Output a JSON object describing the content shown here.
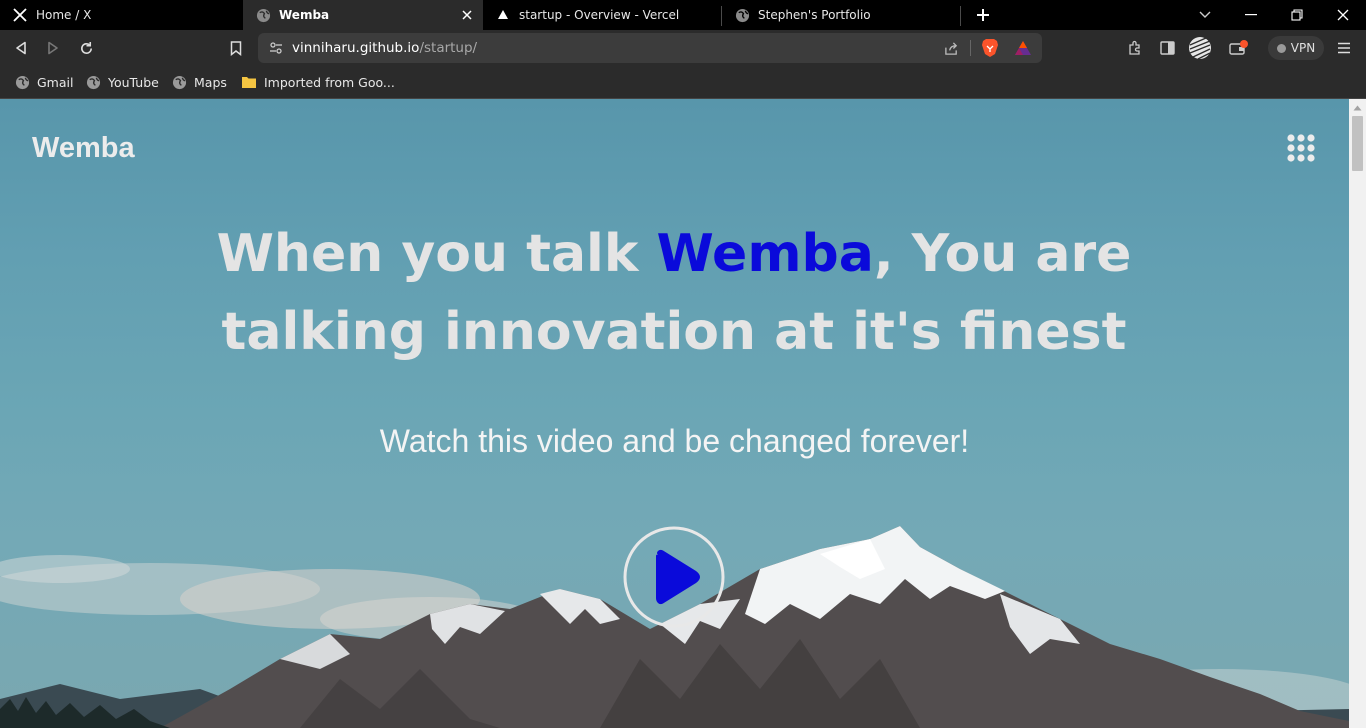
{
  "browser": {
    "tabs": [
      {
        "title": "Home / X",
        "icon": "x-logo-icon",
        "active": false
      },
      {
        "title": "Wemba",
        "icon": "globe-icon",
        "active": true
      },
      {
        "title": "startup - Overview - Vercel",
        "icon": "vercel-triangle-icon",
        "active": false
      },
      {
        "title": "Stephen's Portfolio",
        "icon": "globe-icon",
        "active": false
      }
    ],
    "address": {
      "host": "vinniharu.github.io",
      "path": "/startup/"
    },
    "vpn_label": "VPN",
    "bookmarks": [
      {
        "label": "Gmail",
        "icon": "globe-icon"
      },
      {
        "label": "YouTube",
        "icon": "globe-icon"
      },
      {
        "label": "Maps",
        "icon": "globe-icon"
      },
      {
        "label": "Imported from Goo...",
        "icon": "folder-icon"
      }
    ],
    "colors": {
      "tab_bar": "#000000",
      "toolbar": "#2b2b2b",
      "url_bar": "#3c3c3c",
      "brave_orange": "#fb542b"
    }
  },
  "page": {
    "brand": "Wemba",
    "headline_before": "When you talk ",
    "headline_highlight": "Wemba",
    "headline_after": ", You are talking innovation at it's finest",
    "subheading": "Watch this video and be changed forever!",
    "colors": {
      "highlight": "#0a0ada",
      "play_icon": "#0a0ada",
      "headline_text": "#e4e4e4"
    }
  }
}
